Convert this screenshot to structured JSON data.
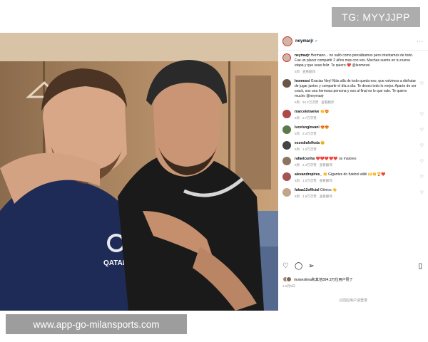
{
  "watermarks": {
    "top_right": "TG: MYYJJPP",
    "bottom_left": "www.app-go-milansports.com"
  },
  "photo": {
    "jersey_text": "QATAR AIRWAYS"
  },
  "post": {
    "username": "neymarjr",
    "more_icon": "ellipsis-icon",
    "caption": {
      "username": "neymarjr",
      "text": "Hermano... no salió como pensábamos pero intentamos de todo. Fue un placer compartir 2 años mas con vos. Muchas suerte en tu nueva etapa y que seas feliz. Te quiero ❤️ @leomessi",
      "time": "5周",
      "translate": "查看翻译"
    },
    "comments": [
      {
        "username": "leomessi",
        "text": "Gracias Ney! Más allá de todo queda eso, que volvimos a disfrutar de jugar juntos y compartir el día a día. Te deseo todo lo mejor. Aparte de ser crack, sos una hermosa persona y eso al final es lo que vale. Te quiero mucho @neymarjr",
        "time": "5周",
        "likes": "34.2万次赞",
        "translate": "查看翻译"
      },
      {
        "username": "marcelotwelve",
        "text": "👏😍",
        "time": "5周",
        "likes": "2.7万次赞"
      },
      {
        "username": "lucelsoglovani",
        "text": "😍😍",
        "time": "5周",
        "likes": "2.4万次赞"
      },
      {
        "username": "essediafolfoda",
        "text": "😊",
        "time": "5周",
        "likes": "1.0万次赞"
      },
      {
        "username": "rafaelcunha",
        "text": "❤️❤️❤️❤️❤️ os maiores",
        "time": "5周",
        "likes": "2.4万次赞",
        "translate": "查看翻译"
      },
      {
        "username": "alexandrepires_",
        "text": "👏 Gigantes do futebol aiiiiii 🙌👏🏆❤️",
        "time": "5周",
        "likes": "1.0万次赞",
        "translate": "查看翻译"
      },
      {
        "username": "fakaa12official",
        "text": "Gênios 👏",
        "time": "5周",
        "likes": "4.6万次赞",
        "translate": "查看翻译"
      }
    ],
    "actions": {
      "like": "heart-icon",
      "comment": "comment-icon",
      "share": "share-icon",
      "save": "bookmark-icon"
    },
    "likes_text": "moiseslima和其他394.3万位用户赞了",
    "date": "1-6月9日",
    "login_prompt": "以回应用户请登录",
    "colors": {
      "verified": "#3897f0",
      "story_ring": "#dd3333",
      "meta": "#8e8e8e"
    }
  }
}
